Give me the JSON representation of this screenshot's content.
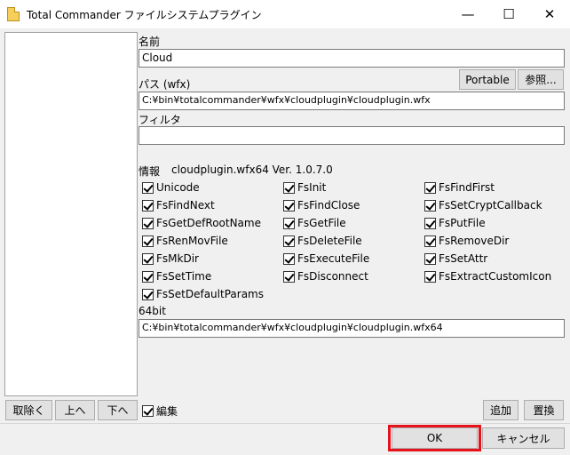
{
  "window": {
    "title": "Total Commander ファイルシステムプラグイン",
    "minimize": "—",
    "maximize": "☐",
    "close": "✕"
  },
  "fields": {
    "name_label": "名前",
    "name_value": "Cloud",
    "path_label": "パス (wfx)",
    "path_value": "C:¥bin¥totalcommander¥wfx¥cloudplugin¥cloudplugin.wfx",
    "portable_button": "Portable",
    "browse_button": "参照...",
    "filter_label": "フィルタ",
    "filter_value": "",
    "info_label": "情報",
    "info_value": "cloudplugin.wfx64 Ver. 1.0.7.0",
    "bit64_label": "64bit",
    "bit64_value": "C:¥bin¥totalcommander¥wfx¥cloudplugin¥cloudplugin.wfx64"
  },
  "functions": {
    "col1": [
      "Unicode",
      "FsFindNext",
      "FsGetDefRootName",
      "FsRenMovFile",
      "FsMkDir",
      "FsSetTime",
      "FsSetDefaultParams"
    ],
    "col2": [
      "FsInit",
      "FsFindClose",
      "FsGetFile",
      "FsDeleteFile",
      "FsExecuteFile",
      "FsDisconnect"
    ],
    "col3": [
      "FsFindFirst",
      "FsSetCryptCallback",
      "FsPutFile",
      "FsRemoveDir",
      "FsSetAttr",
      "FsExtractCustomIcon"
    ]
  },
  "list_buttons": {
    "remove": "取除く",
    "up": "上へ",
    "down": "下へ",
    "edit_checkbox": "編集"
  },
  "action_buttons": {
    "add": "追加",
    "replace": "置換",
    "ok": "OK",
    "cancel": "キャンセル"
  },
  "highlight_color": "#e5141c"
}
